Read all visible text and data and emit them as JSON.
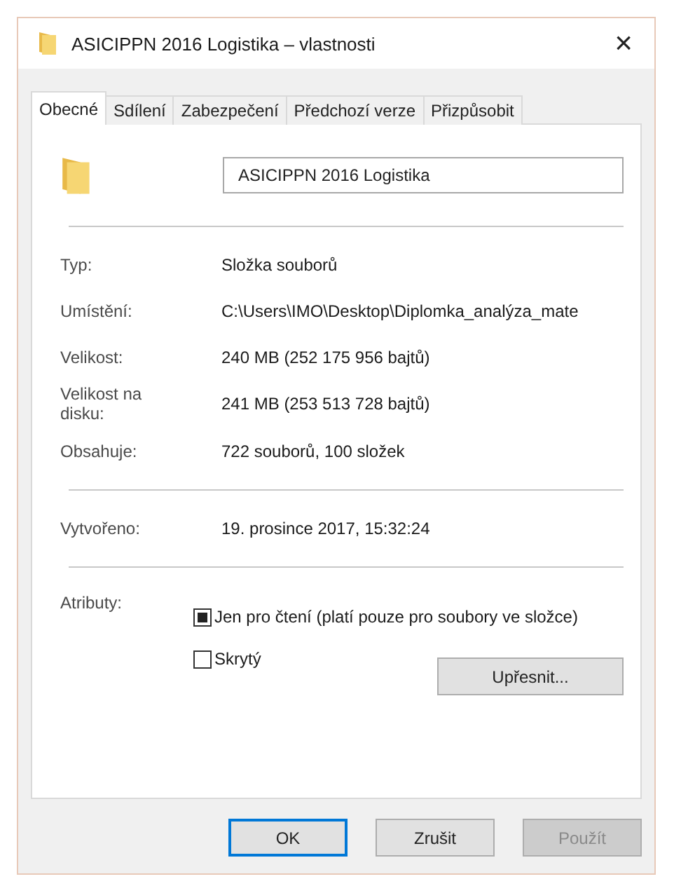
{
  "window": {
    "title": "ASICIPPN 2016 Logistika – vlastnosti",
    "close": "×"
  },
  "tabs": [
    {
      "label": "Obecné",
      "selected": true
    },
    {
      "label": "Sdílení",
      "selected": false
    },
    {
      "label": "Zabezpečení",
      "selected": false
    },
    {
      "label": "Předchozí verze",
      "selected": false
    },
    {
      "label": "Přizpůsobit",
      "selected": false
    }
  ],
  "name_field": {
    "value": "ASICIPPN 2016 Logistika"
  },
  "groups": [
    [
      {
        "label": "Typ:",
        "value": "Složka souborů"
      },
      {
        "label": "Umístění:",
        "value": "C:\\Users\\IMO\\Desktop\\Diplomka_analýza_mate"
      },
      {
        "label": "Velikost:",
        "value": "240 MB (252 175 956 bajtů)"
      },
      {
        "label": "Velikost na disku:",
        "value": "241 MB (253 513 728 bajtů)"
      },
      {
        "label": "Obsahuje:",
        "value": "722 souborů, 100 složek"
      }
    ],
    [
      {
        "label": "Vytvořeno:",
        "value": "19. prosince 2017, 15:32:24"
      }
    ]
  ],
  "attributes": {
    "label": "Atributy:",
    "items": [
      {
        "label": "Jen pro čtení (platí pouze pro soubory ve složce)",
        "indeterminate": true
      },
      {
        "label": "Skrytý",
        "indeterminate": false
      }
    ],
    "advanced_button": "Upřesnit..."
  },
  "buttons": [
    {
      "label": "OK",
      "default": true,
      "disabled": false
    },
    {
      "label": "Zrušit",
      "default": false,
      "disabled": false
    },
    {
      "label": "Použít",
      "default": false,
      "disabled": true
    }
  ]
}
